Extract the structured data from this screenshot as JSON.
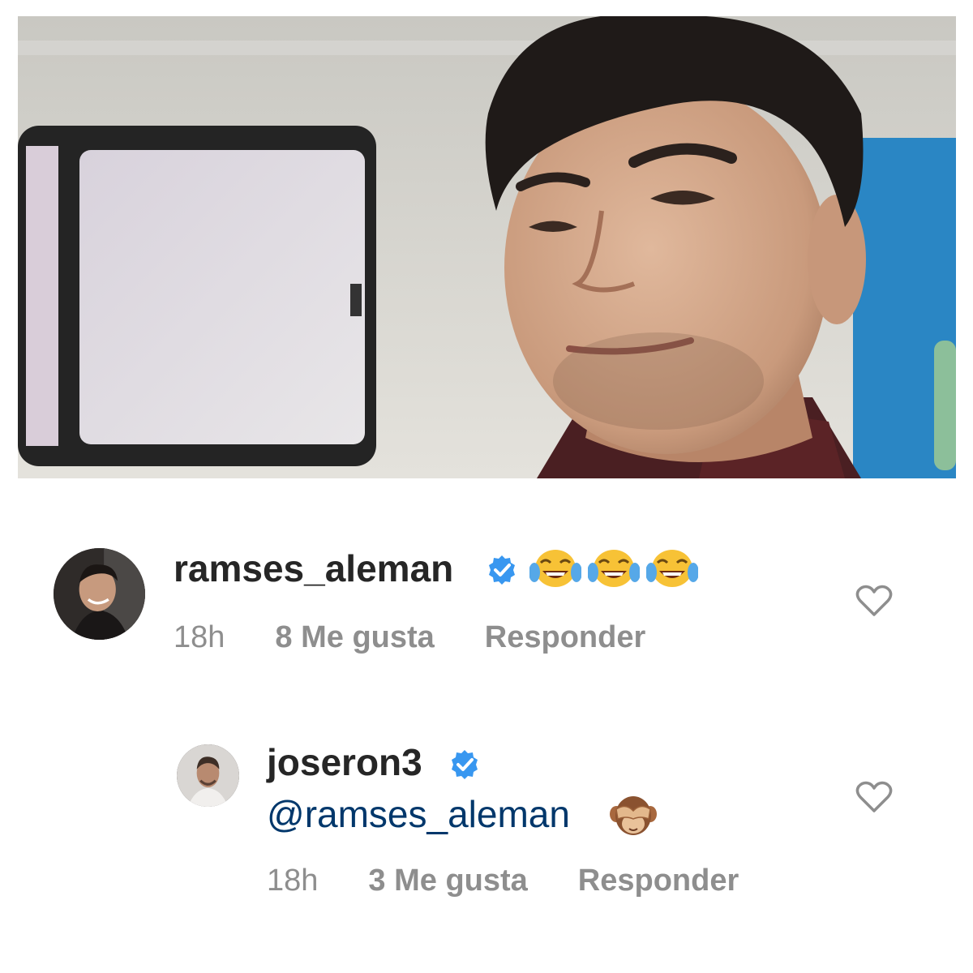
{
  "post": {
    "photo_icon": "photo-man-portrait"
  },
  "comments": [
    {
      "username": "ramses_aleman",
      "verified": true,
      "text_emoji": [
        "face-with-tears-of-joy",
        "face-with-tears-of-joy",
        "face-with-tears-of-joy"
      ],
      "time": "18h",
      "likes": "8 Me gusta",
      "reply": "Responder"
    },
    {
      "username": "joseron3",
      "verified": true,
      "mention": "@ramses_aleman",
      "text_emoji": [
        "see-no-evil-monkey"
      ],
      "time": "18h",
      "likes": "3 Me gusta",
      "reply": "Responder"
    }
  ],
  "colors": {
    "username": "#262626",
    "meta": "#8e8e8e",
    "mention": "#00376b",
    "verified": "#3897f0"
  }
}
